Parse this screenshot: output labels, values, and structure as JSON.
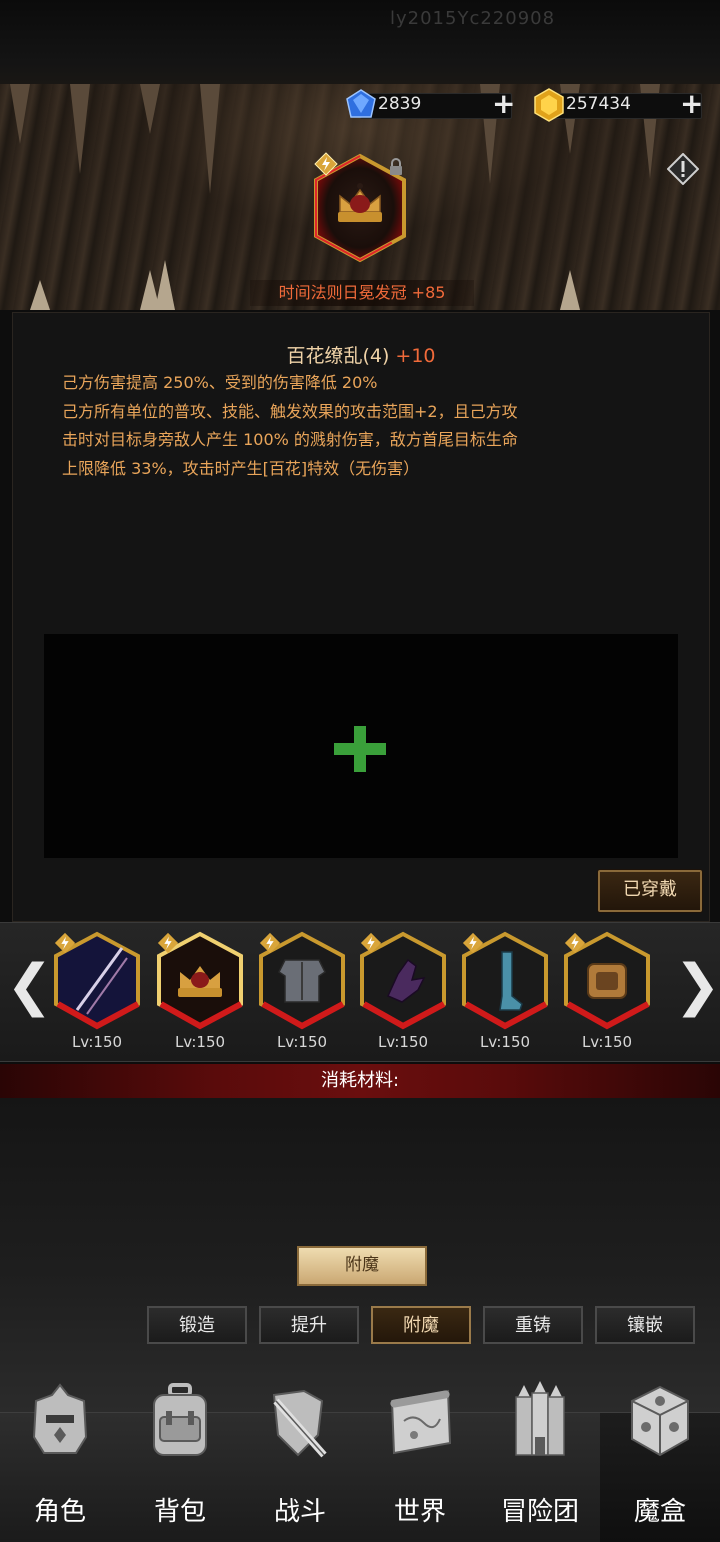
{
  "header": {
    "faint_text": "ly2015Yc220908",
    "gems": {
      "value": "2839",
      "icon": "blue-gem-icon",
      "plus": "+"
    },
    "gold": {
      "value": "257434",
      "icon": "gold-crystal-icon",
      "plus": "+"
    },
    "alert_icon": "warning-icon"
  },
  "item": {
    "name": "时间法则日冕发冠",
    "enhance": "+85",
    "icon": "crown-icon"
  },
  "set_info": {
    "name": "百花缭乱(4)",
    "bonus": "+10",
    "effect_lines": [
      "己方伤害提高 250%、受到的伤害降低 20%",
      "己方所有单位的普攻、技能、触发效果的攻击范围+2，且己方攻",
      "击时对目标身旁敌人产生 100% 的溅射伤害，敌方首尾目标生命",
      "上限降低 33%，攻击时产生[百花]特效（无伤害）"
    ]
  },
  "enchant_slot": {
    "icon": "plus-icon"
  },
  "equipped_label": "已穿戴",
  "carousel": {
    "left_arrow": "❮",
    "right_arrow": "❯",
    "items": [
      {
        "icon": "sword-icon",
        "level": "Lv:150"
      },
      {
        "icon": "crown-icon",
        "level": "Lv:150"
      },
      {
        "icon": "armor-icon",
        "level": "Lv:150"
      },
      {
        "icon": "gauntlet-icon",
        "level": "Lv:150"
      },
      {
        "icon": "boots-icon",
        "level": "Lv:150"
      },
      {
        "icon": "ring-icon",
        "level": "Lv:150"
      }
    ]
  },
  "materials_label": "消耗材料:",
  "action_button": "附魔",
  "tabs": [
    {
      "label": "锻造",
      "active": false
    },
    {
      "label": "提升",
      "active": false
    },
    {
      "label": "附魔",
      "active": true
    },
    {
      "label": "重铸",
      "active": false
    },
    {
      "label": "镶嵌",
      "active": false
    }
  ],
  "nav": [
    {
      "label": "角色",
      "icon": "helmet-icon"
    },
    {
      "label": "背包",
      "icon": "backpack-icon"
    },
    {
      "label": "战斗",
      "icon": "sword-shield-icon"
    },
    {
      "label": "世界",
      "icon": "map-scroll-icon"
    },
    {
      "label": "冒险团",
      "icon": "castle-icon"
    },
    {
      "label": "魔盒",
      "icon": "magic-box-icon",
      "active": true
    }
  ]
}
